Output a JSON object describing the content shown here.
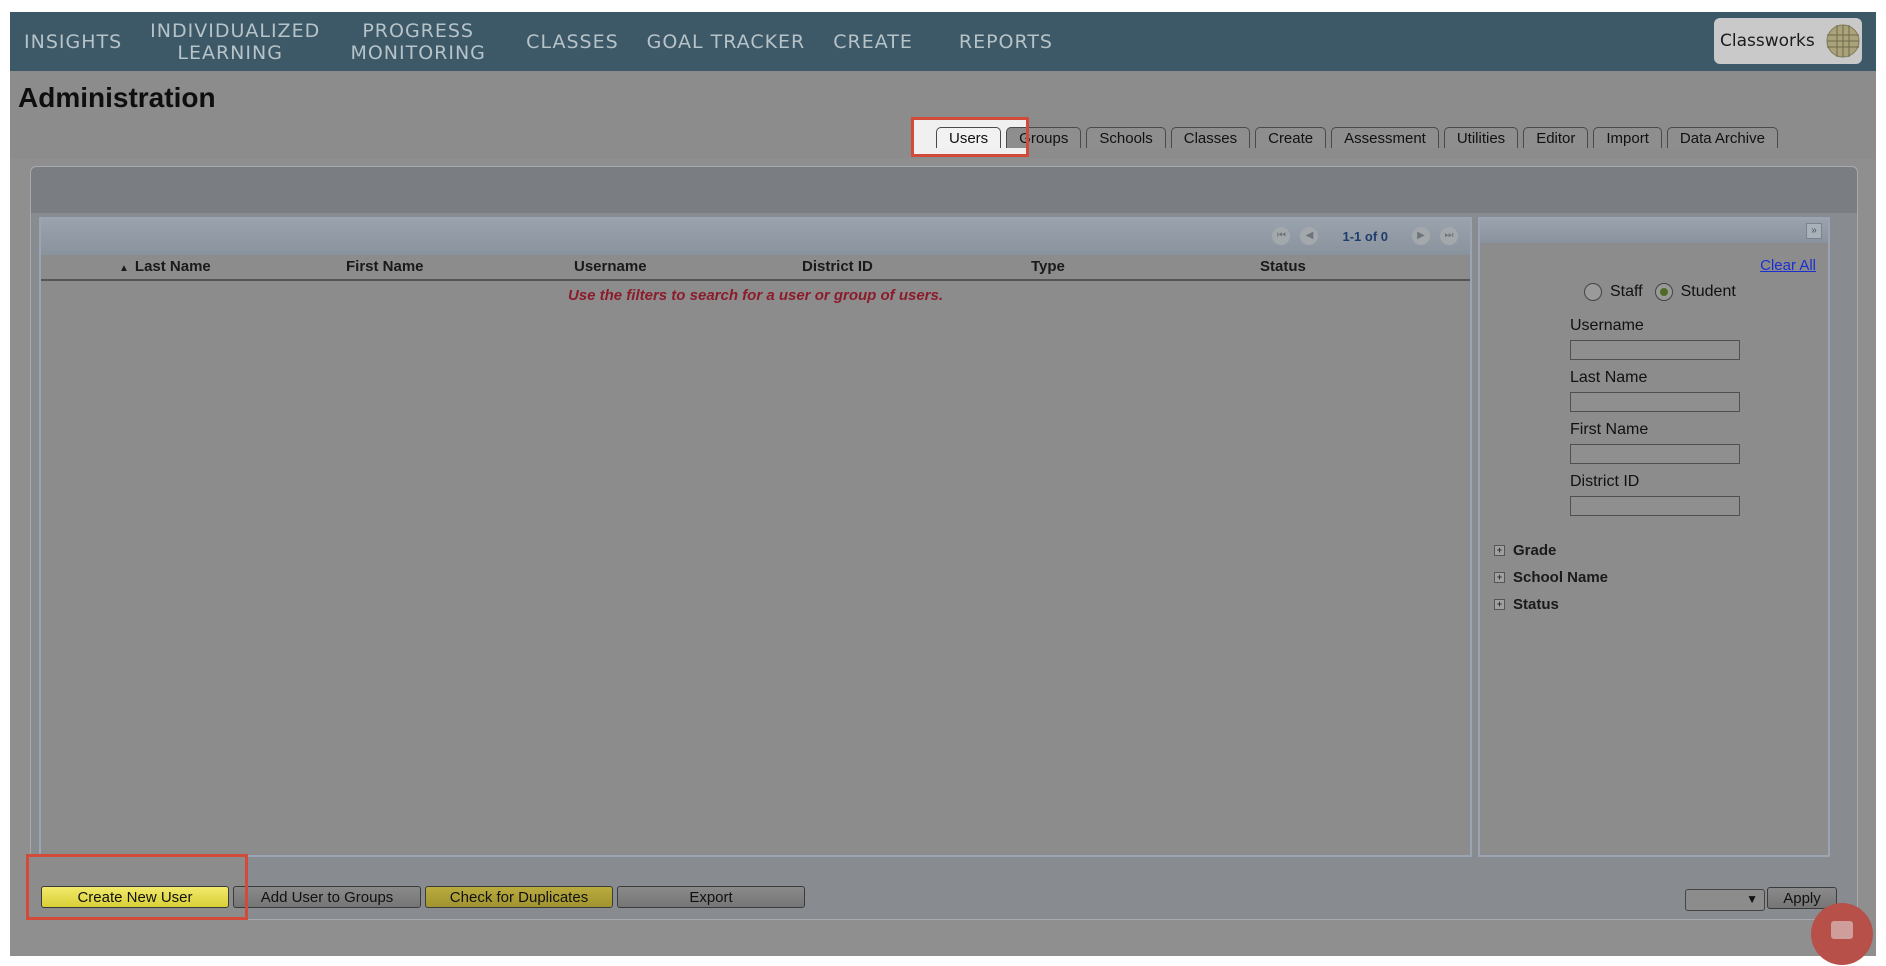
{
  "nav": {
    "items": [
      "INSIGHTS",
      "INDIVIDUALIZED\nLEARNING",
      "PROGRESS\nMONITORING",
      "CLASSES",
      "GOAL TRACKER",
      "CREATE",
      "REPORTS"
    ],
    "brand": "Classworks"
  },
  "page": {
    "title": "Administration"
  },
  "tabs": [
    "Users",
    "Groups",
    "Schools",
    "Classes",
    "Create",
    "Assessment",
    "Utilities",
    "Editor",
    "Import",
    "Data Archive"
  ],
  "grid": {
    "pager_text": "1-1 of 0",
    "columns": [
      "Last Name",
      "First Name",
      "Username",
      "District ID",
      "Type",
      "Status"
    ],
    "empty_message": "Use the filters to search for a user or group of users."
  },
  "filters": {
    "clear_all": "Clear All",
    "radio_staff": "Staff",
    "radio_student": "Student",
    "selected": "Student",
    "fields": [
      "Username",
      "Last Name",
      "First Name",
      "District ID"
    ],
    "groups": [
      "Grade",
      "School Name",
      "Status"
    ]
  },
  "actions": {
    "create_new_user": "Create New User",
    "add_to_groups": "Add User to Groups",
    "check_duplicates": "Check for Duplicates",
    "export": "Export",
    "apply": "Apply"
  },
  "colors": {
    "nav_bg": "#3d5866",
    "highlight": "#d24b3a",
    "accent_yellow": "#f2ea6a"
  }
}
